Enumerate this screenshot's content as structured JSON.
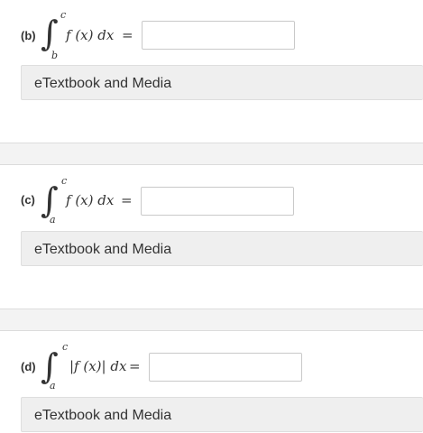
{
  "parts": [
    {
      "label": "(b)",
      "upper": "c",
      "lower": "b",
      "integrand": "f (x) dx",
      "equals": "=",
      "answer_value": "",
      "media_label": "eTextbook and Media"
    },
    {
      "label": "(c)",
      "upper": "c",
      "lower": "a",
      "integrand": "f (x) dx",
      "equals": "=",
      "answer_value": "",
      "media_label": "eTextbook and Media"
    },
    {
      "label": "(d)",
      "upper": "c",
      "lower": "a",
      "integrand": "|f (x)| dx",
      "equals": "=",
      "answer_value": "",
      "media_label": "eTextbook and Media"
    }
  ]
}
